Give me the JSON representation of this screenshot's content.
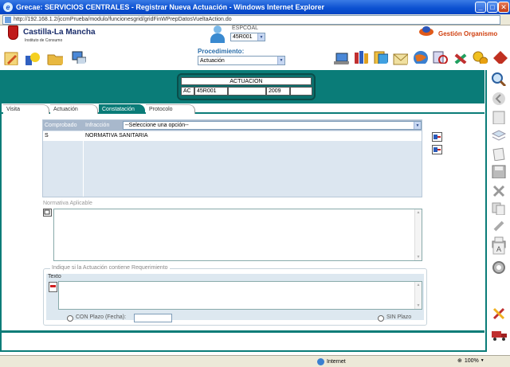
{
  "window": {
    "title": "Grecae: SERVICIOS CENTRALES - Registrar Nueva Actuación - Windows Internet Explorer",
    "url": "http://192.168.1.2/jccmPrueba/modulo/funcionesgrid/gridFinWPrepDatosVueltaAction.do",
    "minimize": "_",
    "maximize": "□",
    "close": "✕"
  },
  "header": {
    "logo_name": "Castilla-La Mancha",
    "logo_sub": "Instituto de Consumo",
    "espcoal_label": "ESPCOAL",
    "espcoal_value": "45R001",
    "gestion_label": "Gestión Organismo",
    "procedimiento_label": "Procedimiento:",
    "procedimiento_value": "Actuación"
  },
  "actuacion": {
    "title": "ACTUACION",
    "cells": [
      "AC",
      "45R001",
      "",
      "2009",
      ""
    ]
  },
  "tabs": [
    {
      "label": "Visita",
      "active": false
    },
    {
      "label": "Actuación",
      "active": false
    },
    {
      "label": "Constatación",
      "active": true
    },
    {
      "label": "Protocolo",
      "active": false
    }
  ],
  "grid": {
    "headers": [
      "Comprobado",
      "Infracción"
    ],
    "select_placeholder": "--Seleccione una opción--",
    "rows": [
      {
        "comprobado": "S",
        "infraccion": "NORMATIVA SANITARIA"
      }
    ]
  },
  "normativa": {
    "label": "Normativa Aplicable"
  },
  "requerimiento": {
    "legend": "Indique si la Actuación contiene Requerimiento",
    "texto_label": "Texto",
    "con_plazo_label": "CON Plazo (Fecha):",
    "sin_plazo_label": "SIN Plazo"
  },
  "status": {
    "zone": "Internet",
    "zoom": "100%"
  },
  "colors": {
    "teal": "#0a7c78",
    "titlebar": "#0a4fd0",
    "grid_header": "#a8b8cc"
  }
}
